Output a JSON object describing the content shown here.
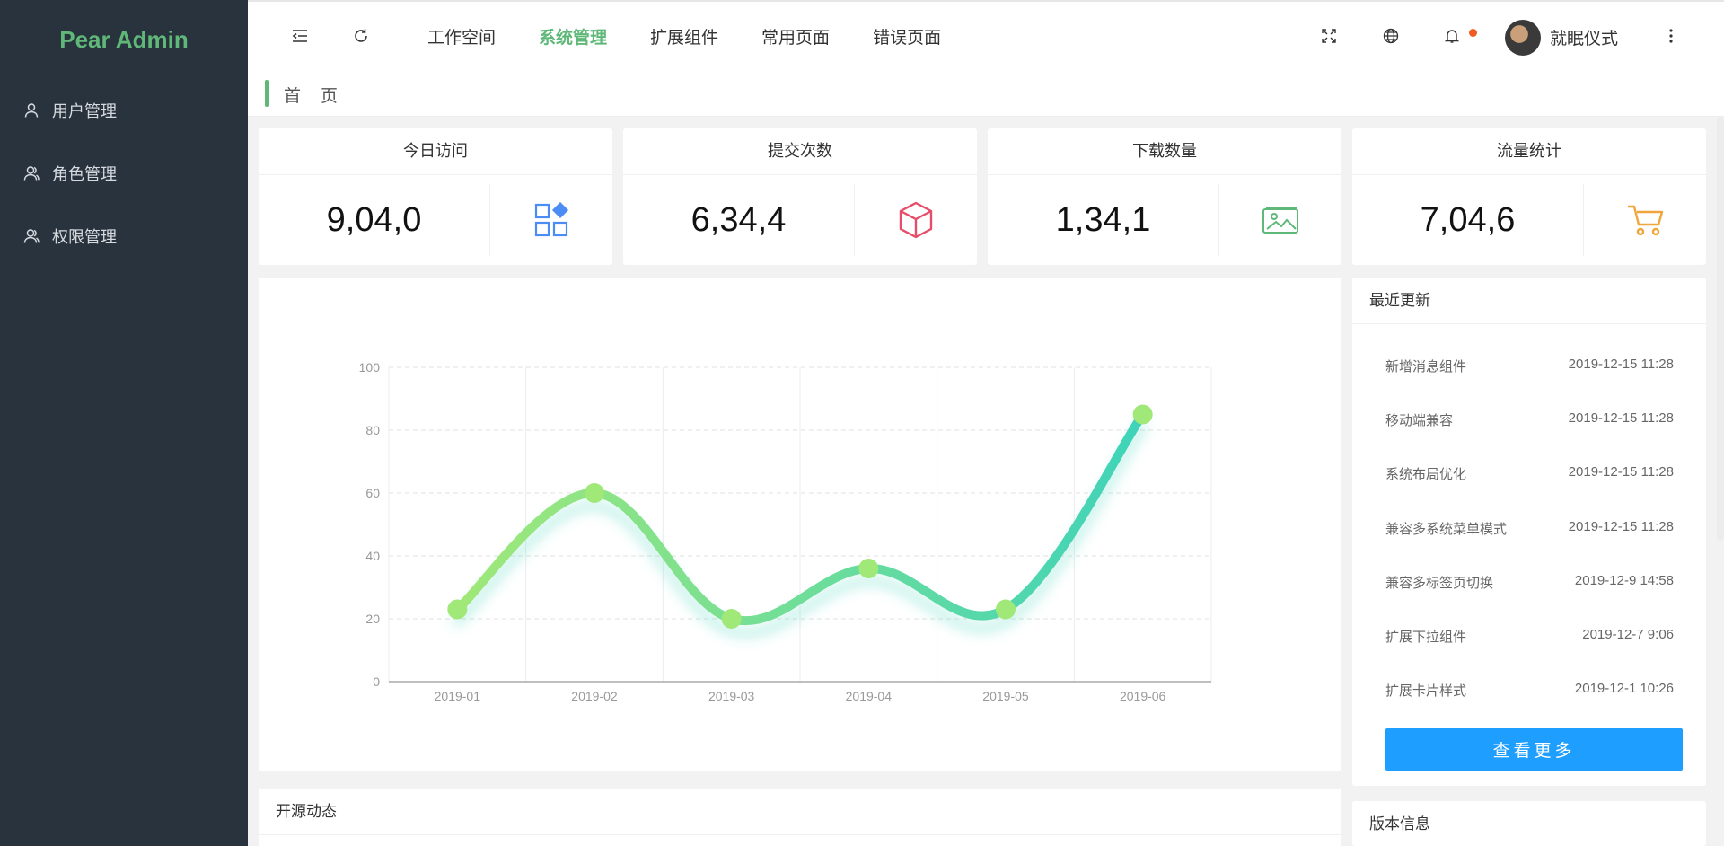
{
  "app": {
    "logo": "Pear Admin"
  },
  "sidebar": {
    "items": [
      {
        "label": "用户管理",
        "icon": "user-icon"
      },
      {
        "label": "角色管理",
        "icon": "users-icon"
      },
      {
        "label": "权限管理",
        "icon": "users-icon"
      }
    ]
  },
  "header": {
    "nav": [
      {
        "label": "工作空间",
        "active": false
      },
      {
        "label": "系统管理",
        "active": true
      },
      {
        "label": "扩展组件",
        "active": false
      },
      {
        "label": "常用页面",
        "active": false
      },
      {
        "label": "错误页面",
        "active": false
      }
    ],
    "username": "就眠仪式",
    "icons": [
      "menu-fold-icon",
      "refresh-icon",
      "fullscreen-icon",
      "globe-icon",
      "bell-icon",
      "more-icon"
    ]
  },
  "tabs": {
    "current": "首 页"
  },
  "stats": [
    {
      "title": "今日访问",
      "value": "9,04,0",
      "icon": "apps-icon",
      "color": "#4c8cf5"
    },
    {
      "title": "提交次数",
      "value": "6,34,4",
      "icon": "cube-icon",
      "color": "#e54d6a"
    },
    {
      "title": "下载数量",
      "value": "1,34,1",
      "icon": "image-icon",
      "color": "#5fb878"
    },
    {
      "title": "流量统计",
      "value": "7,04,6",
      "icon": "cart-icon",
      "color": "#f0a63a"
    }
  ],
  "chart_data": {
    "type": "line",
    "categories": [
      "2019-01",
      "2019-02",
      "2019-03",
      "2019-04",
      "2019-05",
      "2019-06"
    ],
    "values": [
      23,
      60,
      20,
      36,
      23,
      85
    ],
    "ylim": [
      0,
      100
    ],
    "yticks": [
      0,
      20,
      40,
      60,
      80,
      100
    ],
    "smooth": true,
    "grid": true,
    "colors": {
      "start": "#a0e878",
      "end": "#3fd3b9"
    }
  },
  "updates": {
    "title": "最近更新",
    "items": [
      {
        "name": "新增消息组件",
        "time": "2019-12-15 11:28"
      },
      {
        "name": "移动端兼容",
        "time": "2019-12-15 11:28"
      },
      {
        "name": "系统布局优化",
        "time": "2019-12-15 11:28"
      },
      {
        "name": "兼容多系统菜单模式",
        "time": "2019-12-15 11:28"
      },
      {
        "name": "兼容多标签页切换",
        "time": "2019-12-9 14:58"
      },
      {
        "name": "扩展下拉组件",
        "time": "2019-12-7 9:06"
      },
      {
        "name": "扩展卡片样式",
        "time": "2019-12-1 10:26"
      }
    ],
    "more_label": "查看更多"
  },
  "open_source": {
    "title": "开源动态"
  },
  "version": {
    "title": "版本信息"
  }
}
